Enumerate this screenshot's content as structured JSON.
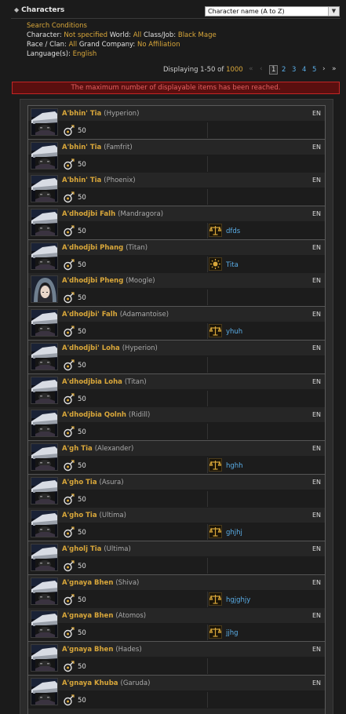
{
  "header": {
    "title": "Characters",
    "sort_value": "Character name (A to Z)"
  },
  "conditions": {
    "heading": "Search Conditions",
    "character_label": "Character:",
    "character_value": "Not specified",
    "world_label": "World:",
    "world_value": "All",
    "classjob_label": "Class/Job:",
    "classjob_value": "Black Mage",
    "race_label": "Race / Clan:",
    "race_value": "All",
    "gc_label": "Grand Company:",
    "gc_value": "No Affiliation",
    "lang_label": "Language(s):",
    "lang_value": "English"
  },
  "pager": {
    "displaying": "Displaying 1-50 of",
    "total": "1000",
    "current": "1",
    "pages": [
      "2",
      "3",
      "4",
      "5"
    ]
  },
  "alert": "The maximum number of displayable items has been reached.",
  "characters": [
    {
      "name": "A'bhin' Tia",
      "world": "(Hyperion)",
      "lang": "EN",
      "level": "50",
      "fc": "",
      "avatar": "hat"
    },
    {
      "name": "A'bhin' Tia",
      "world": "(Famfrit)",
      "lang": "EN",
      "level": "50",
      "fc": "",
      "avatar": "hat"
    },
    {
      "name": "A'bhin' Tia",
      "world": "(Phoenix)",
      "lang": "EN",
      "level": "50",
      "fc": "",
      "avatar": "hat"
    },
    {
      "name": "A'dhodjbi Falh",
      "world": "(Mandragora)",
      "lang": "EN",
      "level": "50",
      "fc": "dfds",
      "fc_icon": "scales",
      "avatar": "hat"
    },
    {
      "name": "A'dhodjbi Phang",
      "world": "(Titan)",
      "lang": "EN",
      "level": "50",
      "fc": "Tita",
      "fc_icon": "sun",
      "avatar": "hat"
    },
    {
      "name": "A'dhodjbi Pheng",
      "world": "(Moogle)",
      "lang": "EN",
      "level": "50",
      "fc": "",
      "avatar": "hood"
    },
    {
      "name": "A'dhodjbi' Falh",
      "world": "(Adamantoise)",
      "lang": "EN",
      "level": "50",
      "fc": "yhuh",
      "fc_icon": "scales",
      "avatar": "hat"
    },
    {
      "name": "A'dhodjbi' Loha",
      "world": "(Hyperion)",
      "lang": "EN",
      "level": "50",
      "fc": "",
      "avatar": "hat"
    },
    {
      "name": "A'dhodjbia Loha",
      "world": "(Titan)",
      "lang": "EN",
      "level": "50",
      "fc": "",
      "avatar": "hat"
    },
    {
      "name": "A'dhodjbia Qolnh",
      "world": "(Ridill)",
      "lang": "EN",
      "level": "50",
      "fc": "",
      "avatar": "hat"
    },
    {
      "name": "A'gh Tia",
      "world": "(Alexander)",
      "lang": "EN",
      "level": "50",
      "fc": "hghh",
      "fc_icon": "scales",
      "avatar": "hat"
    },
    {
      "name": "A'gho Tia",
      "world": "(Asura)",
      "lang": "EN",
      "level": "50",
      "fc": "",
      "avatar": "hat"
    },
    {
      "name": "A'gho Tia",
      "world": "(Ultima)",
      "lang": "EN",
      "level": "50",
      "fc": "ghjhj",
      "fc_icon": "scales",
      "avatar": "hat"
    },
    {
      "name": "A'gholj Tia",
      "world": "(Ultima)",
      "lang": "EN",
      "level": "50",
      "fc": "",
      "avatar": "hat"
    },
    {
      "name": "A'gnaya Bhen",
      "world": "(Shiva)",
      "lang": "EN",
      "level": "50",
      "fc": "hgjghjy",
      "fc_icon": "scales",
      "avatar": "hat"
    },
    {
      "name": "A'gnaya Bhen",
      "world": "(Atomos)",
      "lang": "EN",
      "level": "50",
      "fc": "jjhg",
      "fc_icon": "scales",
      "avatar": "hat"
    },
    {
      "name": "A'gnaya Bhen",
      "world": "(Hades)",
      "lang": "EN",
      "level": "50",
      "fc": "",
      "avatar": "hat"
    },
    {
      "name": "A'gnaya Khuba",
      "world": "(Garuda)",
      "lang": "EN",
      "level": "50",
      "fc": "",
      "avatar": "hat"
    }
  ]
}
